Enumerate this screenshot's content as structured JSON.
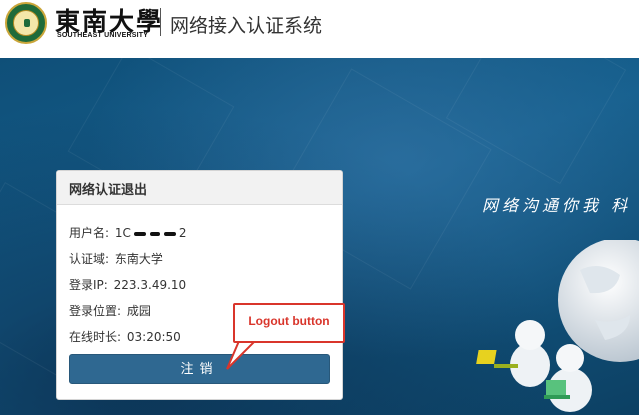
{
  "header": {
    "university_name_cn": "東南大學",
    "university_name_en": "SOUTHEAST UNIVERSITY",
    "system_title": "网络接入认证系统"
  },
  "panel": {
    "title": "网络认证退出",
    "username_label": "用户名:",
    "username_prefix": "1C",
    "username_suffix": "2",
    "domain_label": "认证域:",
    "domain_value": "东南大学",
    "ip_label": "登录IP:",
    "ip_value": "223.3.49.10",
    "location_label": "登录位置:",
    "location_value": "成园",
    "duration_label": "在线时长:",
    "duration_value": "03:20:50",
    "logout_label": "注销"
  },
  "annotation": {
    "callout_text": "Logout button"
  },
  "hero": {
    "slogan": "网络沟通你我  科"
  },
  "colors": {
    "background": "#155f8d",
    "button": "#2f6891",
    "callout": "#d9352b"
  }
}
